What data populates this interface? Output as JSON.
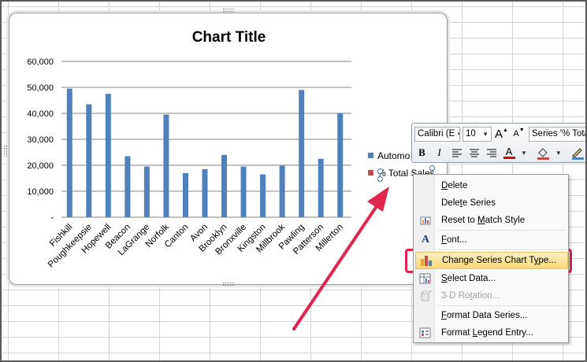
{
  "chart": {
    "title": "Chart Title"
  },
  "chart_data": {
    "type": "bar",
    "title": "Chart Title",
    "categories": [
      "Fishkill",
      "Poughkeepsie",
      "Hopewell",
      "Beacon",
      "LaGrange",
      "Norfolk",
      "Canton",
      "Avon",
      "Brooklyn",
      "Bronxville",
      "Kingston",
      "Millbrook",
      "Pawling",
      "Patterson",
      "Millerton"
    ],
    "series": [
      {
        "name": "Automo",
        "values": [
          49500,
          43500,
          47500,
          23500,
          19500,
          39500,
          17000,
          18500,
          24000,
          19500,
          16500,
          19800,
          49000,
          22500,
          40000
        ]
      },
      {
        "name": "% Total Sales",
        "values": [
          0,
          0,
          0,
          0,
          0,
          0,
          0,
          0,
          0,
          0,
          0,
          0,
          0,
          0,
          0
        ]
      }
    ],
    "ylim": [
      0,
      60000
    ],
    "yticks": [
      "-",
      "10,000",
      "20,000",
      "30,000",
      "40,000",
      "50,000",
      "60,000"
    ],
    "grid": true,
    "legend_position": "right",
    "colors": {
      "series1": "#4f81bd",
      "series2": "#c0504d"
    }
  },
  "legend": {
    "items": [
      {
        "label": "Automo",
        "color": "#4f81bd"
      },
      {
        "label": "% Total Sales",
        "color": "#c0504d"
      }
    ]
  },
  "mini_toolbar": {
    "font": "Calibri (E",
    "size": "10",
    "series_selector": "Series '% Tota",
    "bold": "B",
    "italic": "I",
    "grow_font": "A",
    "shrink_font": "A",
    "font_color_letter": "A"
  },
  "context_menu": {
    "items": [
      {
        "label": "Delete",
        "icon": "none",
        "enabled": true
      },
      {
        "label": "Delete Series",
        "icon": "none",
        "enabled": true
      },
      {
        "label": "Reset to Match Style",
        "icon": "reset-style-icon",
        "enabled": true
      },
      {
        "label": "Font...",
        "icon": "font-icon",
        "enabled": true
      },
      {
        "label": "Change Series Chart Type...",
        "icon": "chart-type-icon",
        "enabled": true
      },
      {
        "label": "Select Data...",
        "icon": "select-data-icon",
        "enabled": true
      },
      {
        "label": "3-D Rotation...",
        "icon": "rotation-icon",
        "enabled": false
      },
      {
        "label": "Format Data Series...",
        "icon": "none",
        "enabled": true
      },
      {
        "label": "Format Legend Entry...",
        "icon": "format-legend-icon",
        "enabled": true
      }
    ]
  },
  "annotation": {
    "arrow_color": "#e0264e"
  }
}
